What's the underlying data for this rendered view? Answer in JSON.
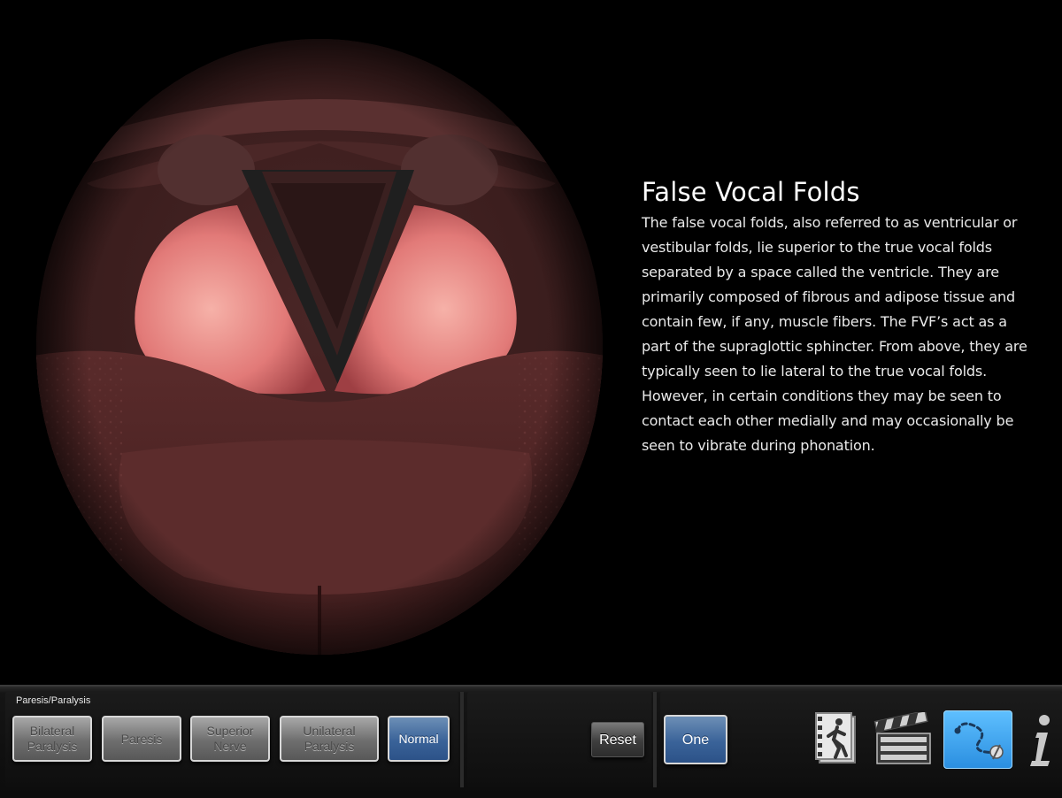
{
  "info": {
    "title": "False Vocal Folds",
    "body": "The false vocal folds, also referred to as ventricular or vestibular folds, lie superior to the true vocal folds separated by a space called the ventricle. They are primarily composed of fibrous and adipose tissue and contain  few, if any, muscle fibers.  The FVF’s act as a part of the supraglottic sphincter.  From above, they are typically seen to lie lateral to the true vocal folds.  However, in certain  conditions they may be seen to contact each other medially and may occasionally be seen to vibrate during phonation."
  },
  "toolbar": {
    "group_label": "Paresis/Paralysis",
    "buttons": {
      "bilateral": "Bilateral\nParalysis",
      "paresis": "Paresis",
      "superior": "Superior\nNerve",
      "unilateral": "Unilateral\nParalysis",
      "normal": "Normal"
    },
    "selected": "Normal",
    "reset_label": "Reset",
    "one_label": "One"
  },
  "icons": {
    "video_clip": "runner-film-icon",
    "movie": "clapperboard-icon",
    "trace": "trace-path-icon",
    "info": "info-icon"
  },
  "colors": {
    "background": "#000000",
    "active_button": "#3a6399",
    "trace_active": "#2a8ee0",
    "false_fold_pink": "#e27a78"
  }
}
